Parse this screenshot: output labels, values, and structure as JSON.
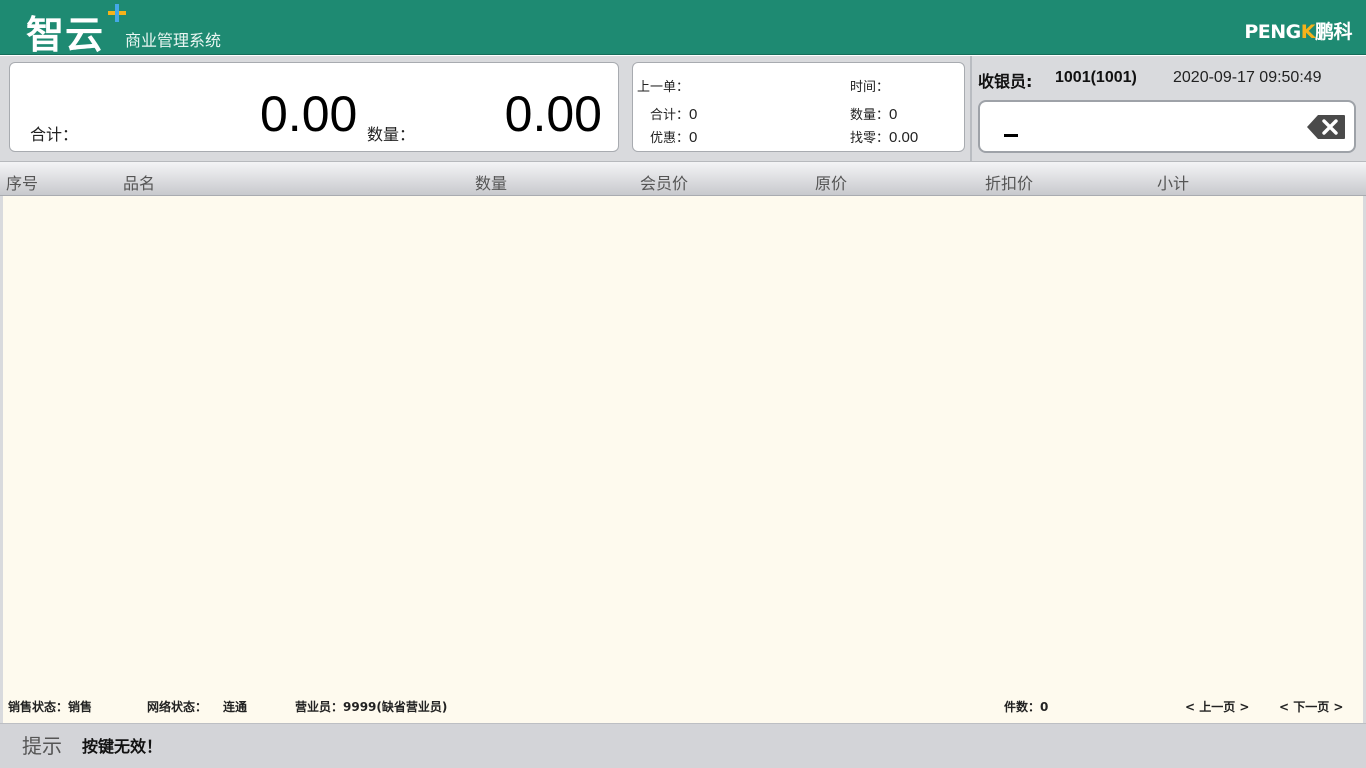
{
  "header": {
    "logo_main": "智云",
    "logo_sub": "商业管理系统",
    "brand_left": "PENG",
    "brand_k": "K",
    "brand_right": "鹏科"
  },
  "totals": {
    "total_label": "合计：",
    "total_value": "0.00",
    "qty_label": "数量：",
    "qty_value": "0.00"
  },
  "last_order": {
    "title": "上一单：",
    "time_label": "时间：",
    "total_label": "合计：",
    "total_value": "0",
    "qty_label": "数量：",
    "qty_value": "0",
    "discount_label": "优惠：",
    "discount_value": "0",
    "change_label": "找零：",
    "change_value": "0.00"
  },
  "cashier": {
    "label": "收银员:",
    "id": "1001(1001)",
    "datetime": "2020-09-17 09:50:49",
    "input_value": ""
  },
  "table": {
    "headers": [
      "序号",
      "品名",
      "数量",
      "会员价",
      "原价",
      "折扣价",
      "小计"
    ],
    "rows": []
  },
  "status_bar": {
    "sale_status": "销售状态：销售",
    "network_label": "网络状态：",
    "network_value": "连通",
    "salesperson": "营业员：9999(缺省营业员)",
    "item_count": "件数：0",
    "prev_page": "< 上一页 >",
    "next_page": "< 下一页 >"
  },
  "hint": {
    "label": "提示",
    "message": "按键无效！"
  },
  "colors": {
    "header_green": "#1e8a72",
    "table_bg": "#fefaee",
    "accent_orange": "#f5b21b"
  },
  "icons": [
    "backspace-icon",
    "logo-plus-icon"
  ]
}
